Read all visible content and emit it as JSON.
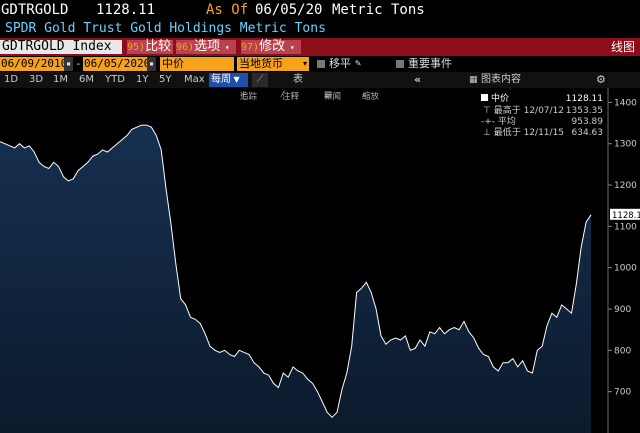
{
  "header": {
    "ticker": "GDTRGOLD",
    "price": "1128.11",
    "as_of_label": "As Of",
    "date": "06/05/20",
    "unit": "Metric Tons",
    "description": "SPDR Gold Trust Gold Holdings Metric Tons"
  },
  "command_bar": {
    "security": "GDTRGOLD Index",
    "btn_compare_num": "95)",
    "btn_compare": "比较",
    "btn_options_num": "96)",
    "btn_options": "选项",
    "btn_edit_num": "97)",
    "btn_edit": "修改",
    "chart_type": "线图"
  },
  "controls": {
    "start_date": "06/09/2010",
    "end_date": "06/05/2020",
    "price_field": "中价",
    "currency": "当地货币",
    "shift_label": "移平",
    "events_label": "重要事件"
  },
  "timeframes": [
    "1D",
    "3D",
    "1M",
    "6M",
    "YTD",
    "1Y",
    "5Y",
    "Max"
  ],
  "period": "每周",
  "table_label": "表",
  "chart_content_label": "图表内容",
  "toolbar": {
    "track": "追踪",
    "annotate": "注释",
    "news": "新闻",
    "zoom": "缩放"
  },
  "legend": {
    "series": "中价",
    "series_value": "1128.11",
    "high_label": "最高于",
    "high_date": "12/07/12",
    "high_value": "1353.35",
    "avg_label": "平均",
    "avg_value": "953.89",
    "low_label": "最低于",
    "low_date": "12/11/15",
    "low_value": "634.63"
  },
  "colors": {
    "accent_orange": "#f7a21b",
    "header_red": "#8c0e1a",
    "title_blue": "#69d3ff",
    "area_fill": "#0f2238"
  },
  "chart_data": {
    "type": "area",
    "x_range": [
      "2010-06-09",
      "2020-06-05"
    ],
    "y_ticks": [
      700,
      800,
      900,
      1000,
      1100,
      1200,
      1300,
      1400
    ],
    "ylim": [
      600,
      1430
    ],
    "last_value_label": "1128.1",
    "x": [
      "2010-06",
      "2010-07",
      "2010-08",
      "2010-09",
      "2010-10",
      "2010-11",
      "2010-12",
      "2011-01",
      "2011-02",
      "2011-03",
      "2011-04",
      "2011-05",
      "2011-06",
      "2011-07",
      "2011-08",
      "2011-09",
      "2011-10",
      "2011-11",
      "2011-12",
      "2012-01",
      "2012-02",
      "2012-03",
      "2012-04",
      "2012-05",
      "2012-06",
      "2012-07",
      "2012-08",
      "2012-09",
      "2012-10",
      "2012-11",
      "2012-12",
      "2013-01",
      "2013-02",
      "2013-03",
      "2013-04",
      "2013-05",
      "2013-06",
      "2013-07",
      "2013-08",
      "2013-09",
      "2013-10",
      "2013-11",
      "2013-12",
      "2014-01",
      "2014-02",
      "2014-03",
      "2014-04",
      "2014-05",
      "2014-06",
      "2014-07",
      "2014-08",
      "2014-09",
      "2014-10",
      "2014-11",
      "2014-12",
      "2015-01",
      "2015-02",
      "2015-03",
      "2015-04",
      "2015-05",
      "2015-06",
      "2015-07",
      "2015-08",
      "2015-09",
      "2015-10",
      "2015-11",
      "2015-12",
      "2016-01",
      "2016-02",
      "2016-03",
      "2016-04",
      "2016-05",
      "2016-06",
      "2016-07",
      "2016-08",
      "2016-09",
      "2016-10",
      "2016-11",
      "2016-12",
      "2017-01",
      "2017-02",
      "2017-03",
      "2017-04",
      "2017-05",
      "2017-06",
      "2017-07",
      "2017-08",
      "2017-09",
      "2017-10",
      "2017-11",
      "2017-12",
      "2018-01",
      "2018-02",
      "2018-03",
      "2018-04",
      "2018-05",
      "2018-06",
      "2018-07",
      "2018-08",
      "2018-09",
      "2018-10",
      "2018-11",
      "2018-12",
      "2019-01",
      "2019-02",
      "2019-03",
      "2019-04",
      "2019-05",
      "2019-06",
      "2019-07",
      "2019-08",
      "2019-09",
      "2019-10",
      "2019-11",
      "2019-12",
      "2020-01",
      "2020-02",
      "2020-03",
      "2020-04",
      "2020-05",
      "2020-06"
    ],
    "series": [
      {
        "values": [
          1305,
          1300,
          1295,
          1290,
          1300,
          1290,
          1295,
          1280,
          1255,
          1245,
          1240,
          1255,
          1245,
          1220,
          1210,
          1215,
          1235,
          1245,
          1255,
          1270,
          1275,
          1285,
          1280,
          1290,
          1300,
          1310,
          1320,
          1335,
          1340,
          1345,
          1345,
          1340,
          1320,
          1285,
          1190,
          1105,
          1010,
          925,
          910,
          880,
          875,
          865,
          840,
          810,
          800,
          795,
          800,
          790,
          785,
          800,
          795,
          790,
          770,
          760,
          745,
          740,
          720,
          710,
          745,
          735,
          760,
          750,
          745,
          730,
          720,
          700,
          675,
          650,
          638,
          650,
          705,
          745,
          810,
          940,
          950,
          965,
          940,
          900,
          835,
          815,
          825,
          830,
          825,
          835,
          800,
          805,
          825,
          810,
          845,
          840,
          855,
          840,
          850,
          855,
          850,
          870,
          845,
          830,
          805,
          790,
          785,
          760,
          750,
          770,
          770,
          780,
          760,
          775,
          750,
          745,
          800,
          810,
          860,
          890,
          880,
          910,
          900,
          890,
          960,
          1050,
          1110,
          1128
        ]
      }
    ]
  }
}
